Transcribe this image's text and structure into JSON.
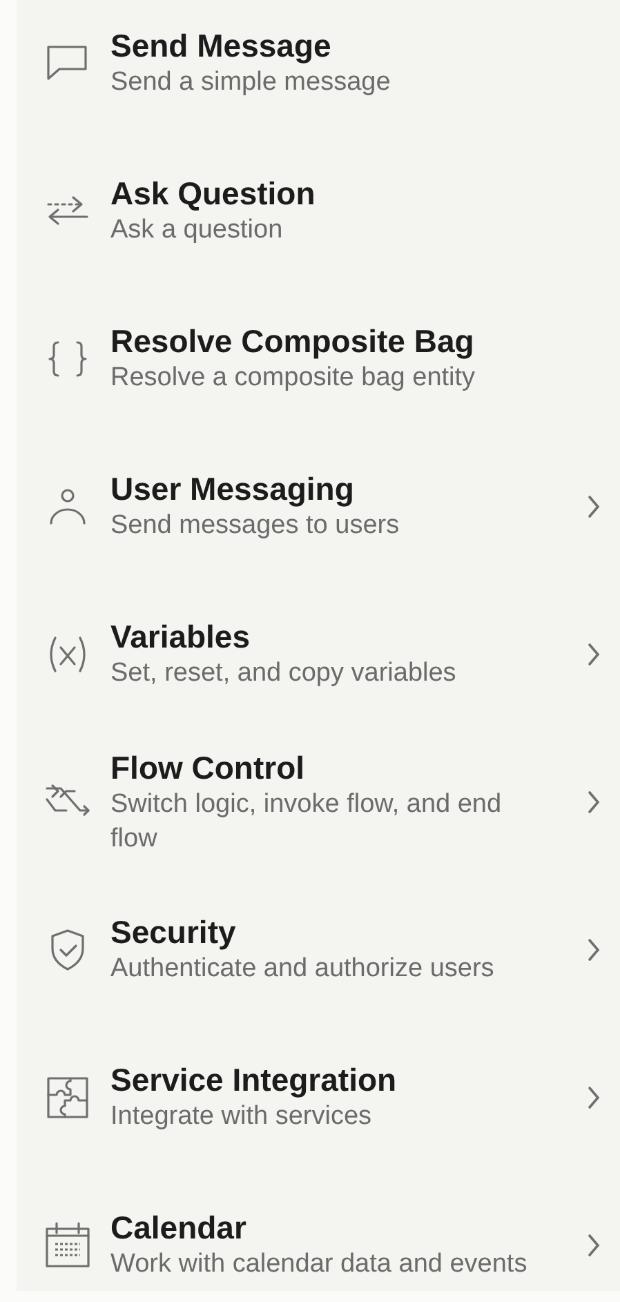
{
  "items": [
    {
      "kind": "message",
      "title": "Send Message",
      "description": "Send a simple message",
      "has_submenu": false
    },
    {
      "kind": "question",
      "title": "Ask Question",
      "description": "Ask a question",
      "has_submenu": false
    },
    {
      "kind": "braces",
      "title": "Resolve Composite Bag",
      "description": "Resolve a composite bag entity",
      "has_submenu": false
    },
    {
      "kind": "user",
      "title": "User Messaging",
      "description": "Send messages to users",
      "has_submenu": true
    },
    {
      "kind": "variable",
      "title": "Variables",
      "description": "Set, reset, and copy variables",
      "has_submenu": true
    },
    {
      "kind": "flow",
      "title": "Flow Control",
      "description": "Switch logic, invoke flow, and end flow",
      "has_submenu": true
    },
    {
      "kind": "shield",
      "title": "Security",
      "description": "Authenticate and authorize users",
      "has_submenu": true
    },
    {
      "kind": "puzzle",
      "title": "Service Integration",
      "description": "Integrate with services",
      "has_submenu": true
    },
    {
      "kind": "calendar",
      "title": "Calendar",
      "description": "Work with calendar data and events",
      "has_submenu": true
    }
  ]
}
